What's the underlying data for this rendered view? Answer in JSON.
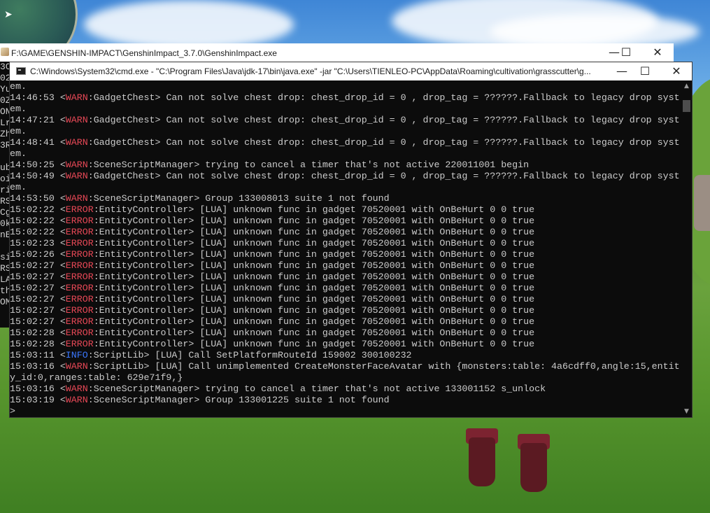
{
  "background_window": {
    "title": "F:\\GAME\\GENSHIN-IMPACT\\GenshinImpact_3.7.0\\GenshinImpact.exe",
    "min": "—",
    "max": "☐",
    "close": "✕"
  },
  "side_strip": [
    "3C",
    "02",
    "Yu",
    "0Z",
    "ON",
    "Lr",
    "Zh",
    "3R",
    "",
    "ub",
    "oi",
    "ri",
    "RS",
    "Cg",
    "0k",
    "nE",
    "",
    "si",
    "RS",
    "LA",
    "th",
    "OM"
  ],
  "console": {
    "title": "C:\\Windows\\System32\\cmd.exe - \"C:\\Program Files\\Java\\jdk-17\\bin\\java.exe\"  -jar \"C:\\Users\\TIENLEO-PC\\AppData\\Roaming\\cultivation\\grasscutter\\g...",
    "min": "—",
    "max": "☐",
    "close": "✕",
    "lines": [
      {
        "pre": "em.",
        "tag": "",
        "level": "",
        "src": "",
        "msg": ""
      },
      {
        "pre": "14:46:53 <",
        "level": "WARN",
        "src": ":GadgetChest> ",
        "msg": "Can not solve chest drop: chest_drop_id = 0 , drop_tag = ??????.Fallback to legacy drop syst"
      },
      {
        "pre": "em.",
        "level": "",
        "src": "",
        "msg": ""
      },
      {
        "pre": "14:47:21 <",
        "level": "WARN",
        "src": ":GadgetChest> ",
        "msg": "Can not solve chest drop: chest_drop_id = 0 , drop_tag = ??????.Fallback to legacy drop syst"
      },
      {
        "pre": "em.",
        "level": "",
        "src": "",
        "msg": ""
      },
      {
        "pre": "14:48:41 <",
        "level": "WARN",
        "src": ":GadgetChest> ",
        "msg": "Can not solve chest drop: chest_drop_id = 0 , drop_tag = ??????.Fallback to legacy drop syst"
      },
      {
        "pre": "em.",
        "level": "",
        "src": "",
        "msg": ""
      },
      {
        "pre": "14:50:25 <",
        "level": "WARN",
        "src": ":SceneScriptManager> ",
        "msg": "trying to cancel a timer that's not active 220011001 begin"
      },
      {
        "pre": "14:50:49 <",
        "level": "WARN",
        "src": ":GadgetChest> ",
        "msg": "Can not solve chest drop: chest_drop_id = 0 , drop_tag = ??????.Fallback to legacy drop syst"
      },
      {
        "pre": "em.",
        "level": "",
        "src": "",
        "msg": ""
      },
      {
        "pre": "14:53:50 <",
        "level": "WARN",
        "src": ":SceneScriptManager> ",
        "msg": "Group 133008013 suite 1 not found"
      },
      {
        "pre": "15:02:22 <",
        "level": "ERROR",
        "src": ":EntityController> ",
        "msg": "[LUA] unknown func in gadget 70520001 with OnBeHurt 0 0 true"
      },
      {
        "pre": "15:02:22 <",
        "level": "ERROR",
        "src": ":EntityController> ",
        "msg": "[LUA] unknown func in gadget 70520001 with OnBeHurt 0 0 true"
      },
      {
        "pre": "15:02:22 <",
        "level": "ERROR",
        "src": ":EntityController> ",
        "msg": "[LUA] unknown func in gadget 70520001 with OnBeHurt 0 0 true"
      },
      {
        "pre": "15:02:23 <",
        "level": "ERROR",
        "src": ":EntityController> ",
        "msg": "[LUA] unknown func in gadget 70520001 with OnBeHurt 0 0 true"
      },
      {
        "pre": "15:02:26 <",
        "level": "ERROR",
        "src": ":EntityController> ",
        "msg": "[LUA] unknown func in gadget 70520001 with OnBeHurt 0 0 true"
      },
      {
        "pre": "15:02:27 <",
        "level": "ERROR",
        "src": ":EntityController> ",
        "msg": "[LUA] unknown func in gadget 70520001 with OnBeHurt 0 0 true"
      },
      {
        "pre": "15:02:27 <",
        "level": "ERROR",
        "src": ":EntityController> ",
        "msg": "[LUA] unknown func in gadget 70520001 with OnBeHurt 0 0 true"
      },
      {
        "pre": "15:02:27 <",
        "level": "ERROR",
        "src": ":EntityController> ",
        "msg": "[LUA] unknown func in gadget 70520001 with OnBeHurt 0 0 true"
      },
      {
        "pre": "15:02:27 <",
        "level": "ERROR",
        "src": ":EntityController> ",
        "msg": "[LUA] unknown func in gadget 70520001 with OnBeHurt 0 0 true"
      },
      {
        "pre": "15:02:27 <",
        "level": "ERROR",
        "src": ":EntityController> ",
        "msg": "[LUA] unknown func in gadget 70520001 with OnBeHurt 0 0 true"
      },
      {
        "pre": "15:02:27 <",
        "level": "ERROR",
        "src": ":EntityController> ",
        "msg": "[LUA] unknown func in gadget 70520001 with OnBeHurt 0 0 true"
      },
      {
        "pre": "15:02:28 <",
        "level": "ERROR",
        "src": ":EntityController> ",
        "msg": "[LUA] unknown func in gadget 70520001 with OnBeHurt 0 0 true"
      },
      {
        "pre": "15:02:28 <",
        "level": "ERROR",
        "src": ":EntityController> ",
        "msg": "[LUA] unknown func in gadget 70520001 with OnBeHurt 0 0 true"
      },
      {
        "pre": "15:03:11 <",
        "level": "INFO",
        "src": ":ScriptLib> ",
        "msg": "[LUA] Call SetPlatformRouteId 159002 300100232"
      },
      {
        "pre": "15:03:16 <",
        "level": "WARN",
        "src": ":ScriptLib> ",
        "msg": "[LUA] Call unimplemented CreateMonsterFaceAvatar with {monsters:table: 4a6cdff0,angle:15,entit"
      },
      {
        "pre": "y_id:0,ranges:table: 629e71f9,}",
        "level": "",
        "src": "",
        "msg": ""
      },
      {
        "pre": "15:03:16 <",
        "level": "WARN",
        "src": ":SceneScriptManager> ",
        "msg": "trying to cancel a timer that's not active 133001152 s_unlock"
      },
      {
        "pre": "15:03:19 <",
        "level": "WARN",
        "src": ":SceneScriptManager> ",
        "msg": "Group 133001225 suite 1 not found"
      },
      {
        "pre": ">",
        "level": "",
        "src": "",
        "msg": ""
      }
    ],
    "colors": {
      "warn": "#e74856",
      "error": "#e74856",
      "info": "#3b78ff",
      "text": "#cccccc",
      "bg": "#0c0c0c"
    }
  }
}
